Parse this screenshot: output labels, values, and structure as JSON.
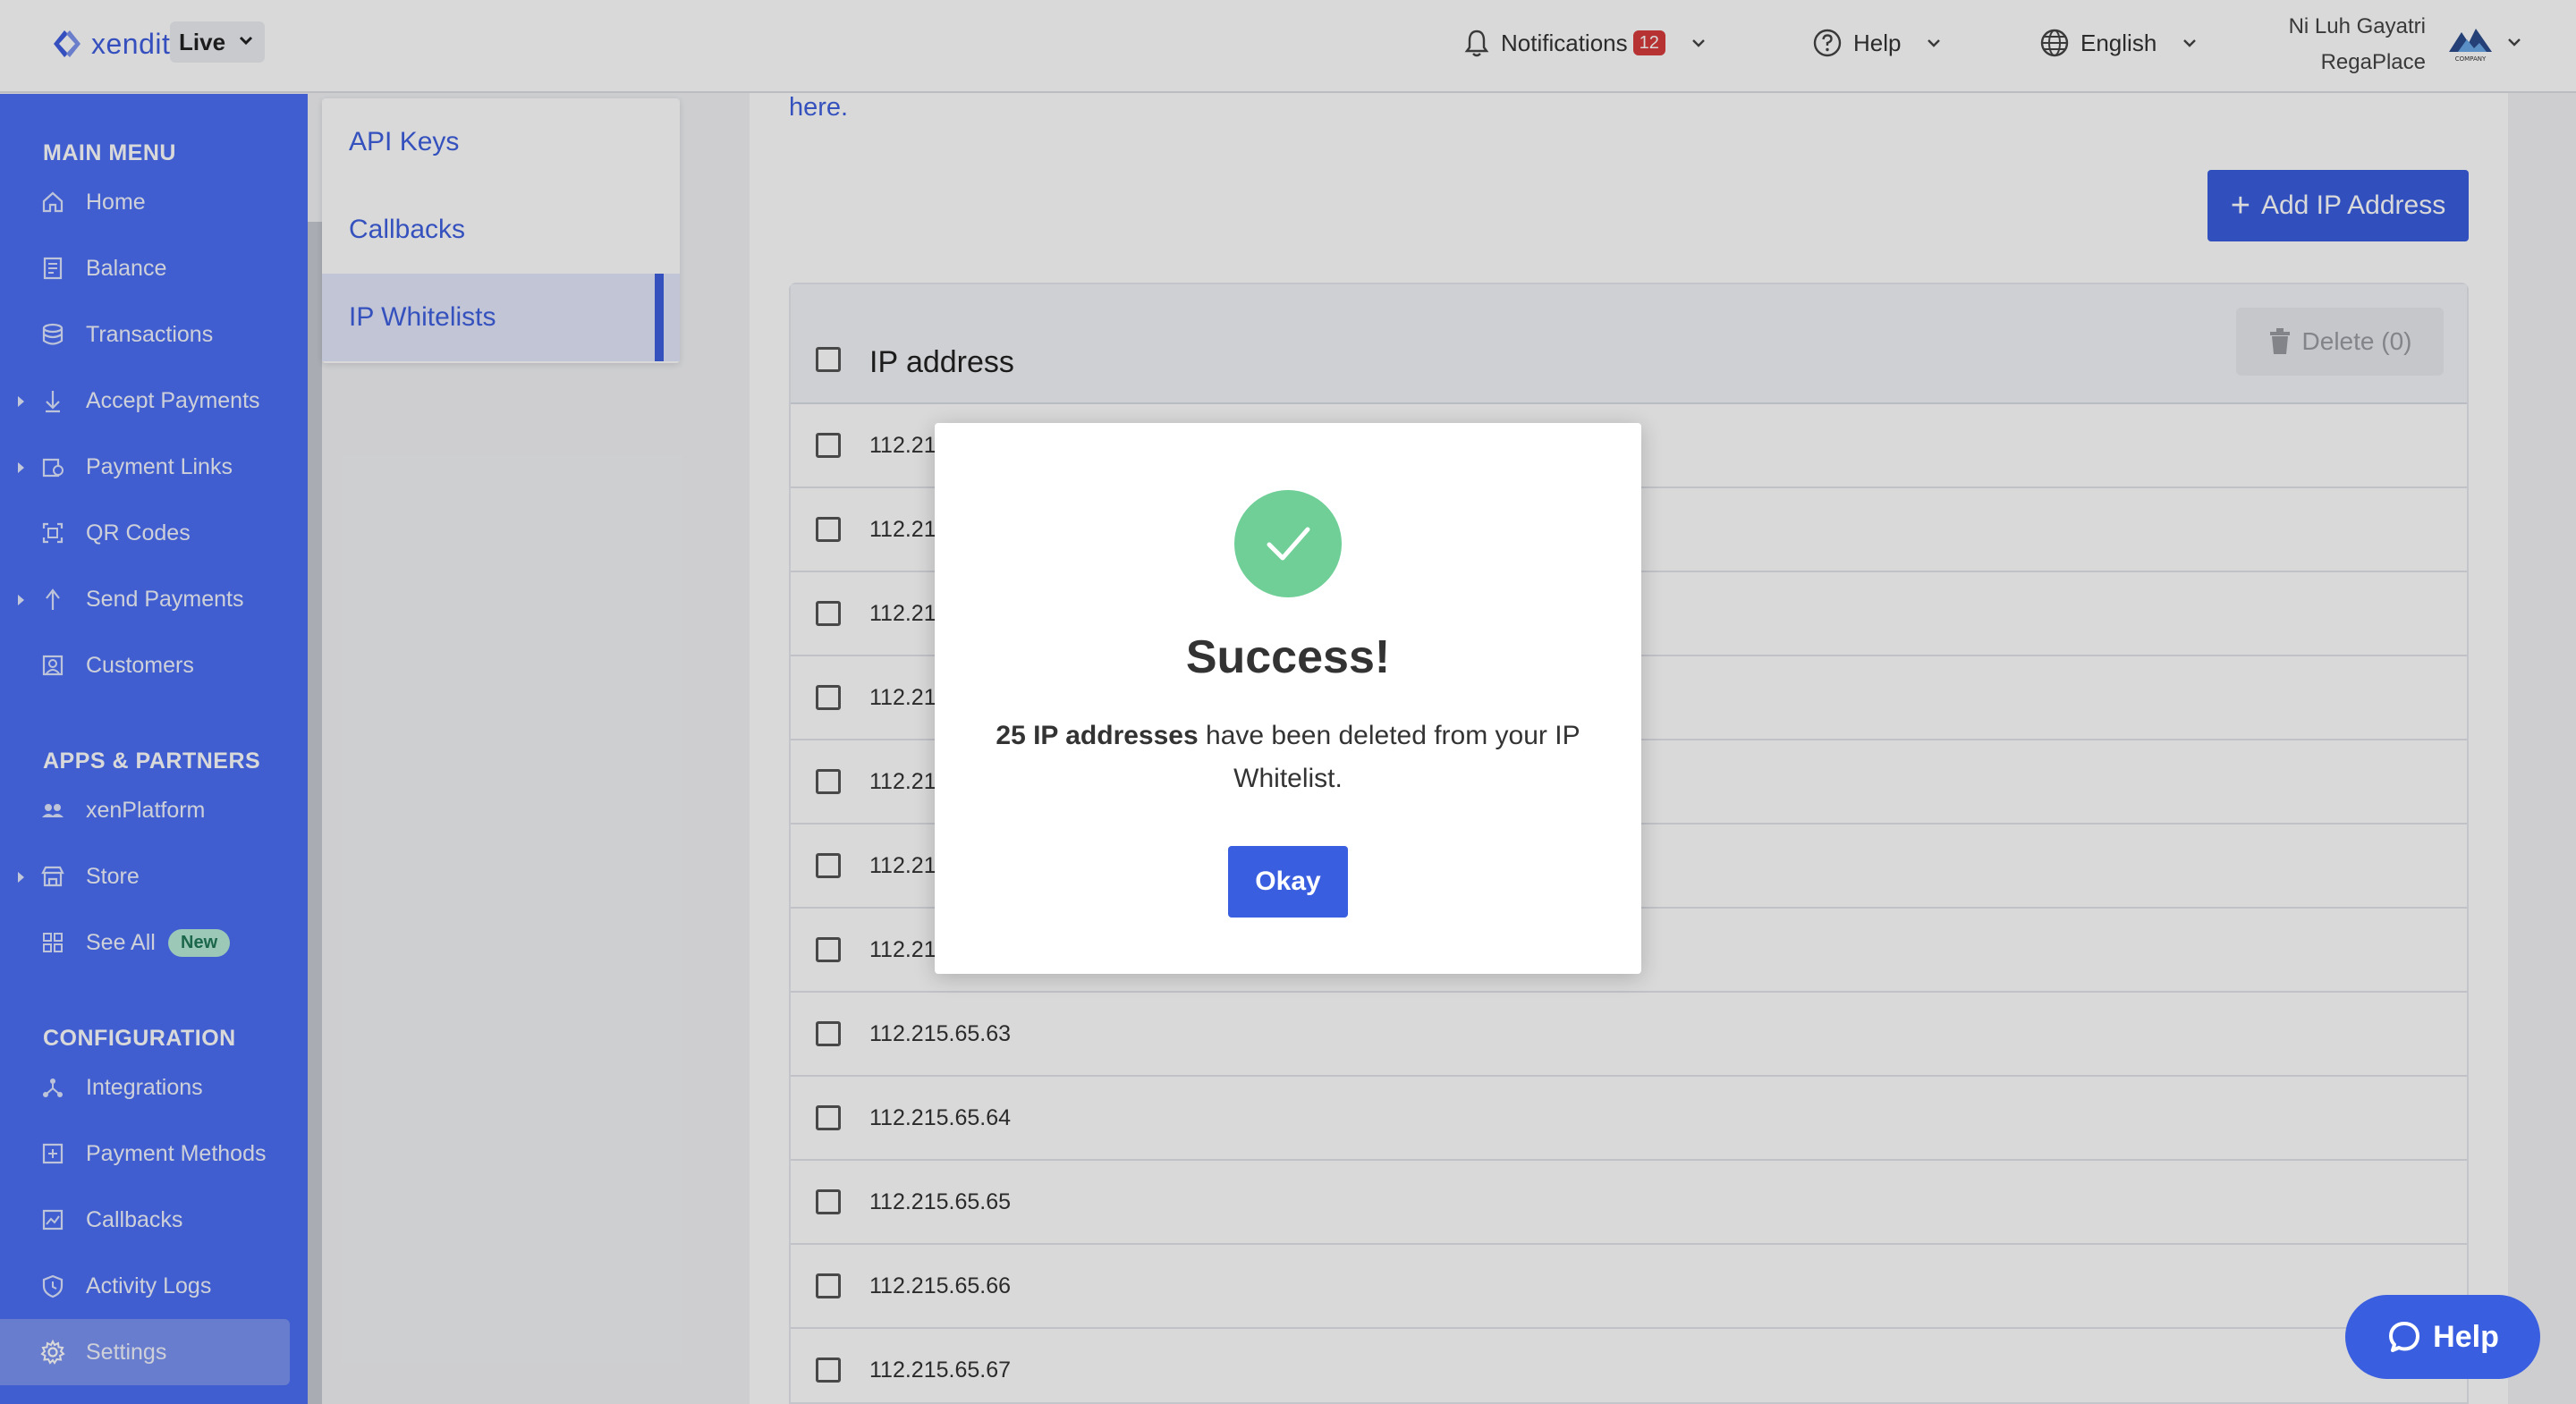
{
  "header": {
    "brand": "xendit",
    "environment": "Live",
    "notifications_label": "Notifications",
    "notifications_count": "12",
    "help_label": "Help",
    "language_label": "English",
    "user_name": "Ni Luh Gayatri",
    "company_name": "RegaPlace",
    "company_logo_text": "COMPANY"
  },
  "sidebar": {
    "main_menu_heading": "MAIN MENU",
    "main_items": [
      {
        "label": "Home",
        "icon": "home-icon"
      },
      {
        "label": "Balance",
        "icon": "balance-icon"
      },
      {
        "label": "Transactions",
        "icon": "transactions-icon"
      },
      {
        "label": "Accept Payments",
        "icon": "accept-payments-icon"
      },
      {
        "label": "Payment Links",
        "icon": "payment-links-icon"
      },
      {
        "label": "QR Codes",
        "icon": "qr-code-icon"
      },
      {
        "label": "Send Payments",
        "icon": "send-payments-icon"
      },
      {
        "label": "Customers",
        "icon": "customers-icon"
      }
    ],
    "apps_heading": "APPS & PARTNERS",
    "apps_items": [
      {
        "label": "xenPlatform",
        "icon": "xenplatform-icon"
      },
      {
        "label": "Store",
        "icon": "store-icon"
      },
      {
        "label": "See All",
        "icon": "see-all-icon",
        "badge": "New"
      }
    ],
    "config_heading": "CONFIGURATION",
    "config_items": [
      {
        "label": "Integrations",
        "icon": "integrations-icon"
      },
      {
        "label": "Payment Methods",
        "icon": "payment-methods-icon"
      },
      {
        "label": "Callbacks",
        "icon": "callbacks-icon"
      },
      {
        "label": "Activity Logs",
        "icon": "activity-logs-icon"
      },
      {
        "label": "Settings",
        "icon": "gear-icon"
      }
    ]
  },
  "subnav": {
    "items": [
      {
        "label": "API Keys"
      },
      {
        "label": "Callbacks"
      },
      {
        "label": "IP Whitelists"
      }
    ]
  },
  "main": {
    "link_text": "here.",
    "add_button": "Add IP Address",
    "table_header": "IP address",
    "delete_button": "Delete (0)",
    "rows": [
      "112.21",
      "112.21",
      "112.21",
      "112.21",
      "112.21",
      "112.21",
      "112.21",
      "112.215.65.63",
      "112.215.65.64",
      "112.215.65.65",
      "112.215.65.66",
      "112.215.65.67"
    ]
  },
  "modal": {
    "title": "Success!",
    "message_bold": "25 IP addresses",
    "message_rest": " have been deleted from your IP Whitelist.",
    "button": "Okay"
  },
  "help_fab": {
    "label": "Help"
  },
  "colors": {
    "accent": "#3a5ee0",
    "sidebar": "#4c6ff5",
    "success": "#6fcf97",
    "badge_red": "#d73c3c"
  }
}
